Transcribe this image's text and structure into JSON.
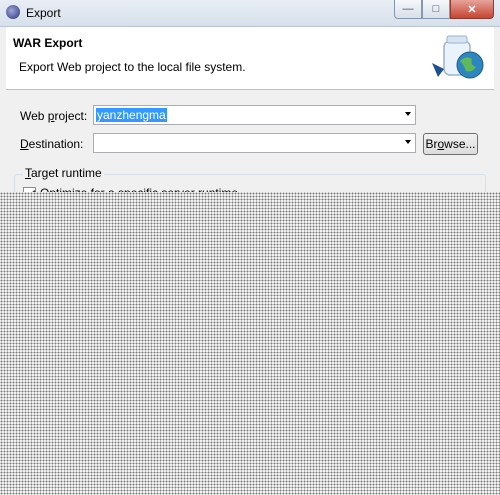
{
  "window": {
    "title": "Export"
  },
  "header": {
    "title": "WAR Export",
    "description": "Export Web project to the local file system."
  },
  "form": {
    "web_project": {
      "label_pre": "Web ",
      "label_key": "p",
      "label_post": "roject:",
      "value": "yanzhengma"
    },
    "destination": {
      "label_key": "D",
      "label_post": "estination:",
      "value": ""
    },
    "browse_pre": "Br",
    "browse_key": "o",
    "browse_post": "wse..."
  },
  "target_runtime": {
    "title_key": "T",
    "title_post": "arget runtime",
    "option_label": "Optimize for a specific server runtime",
    "option_checked": true
  },
  "icons": {
    "app": "eclipse-icon",
    "wizard": "jar-globe-icon"
  }
}
